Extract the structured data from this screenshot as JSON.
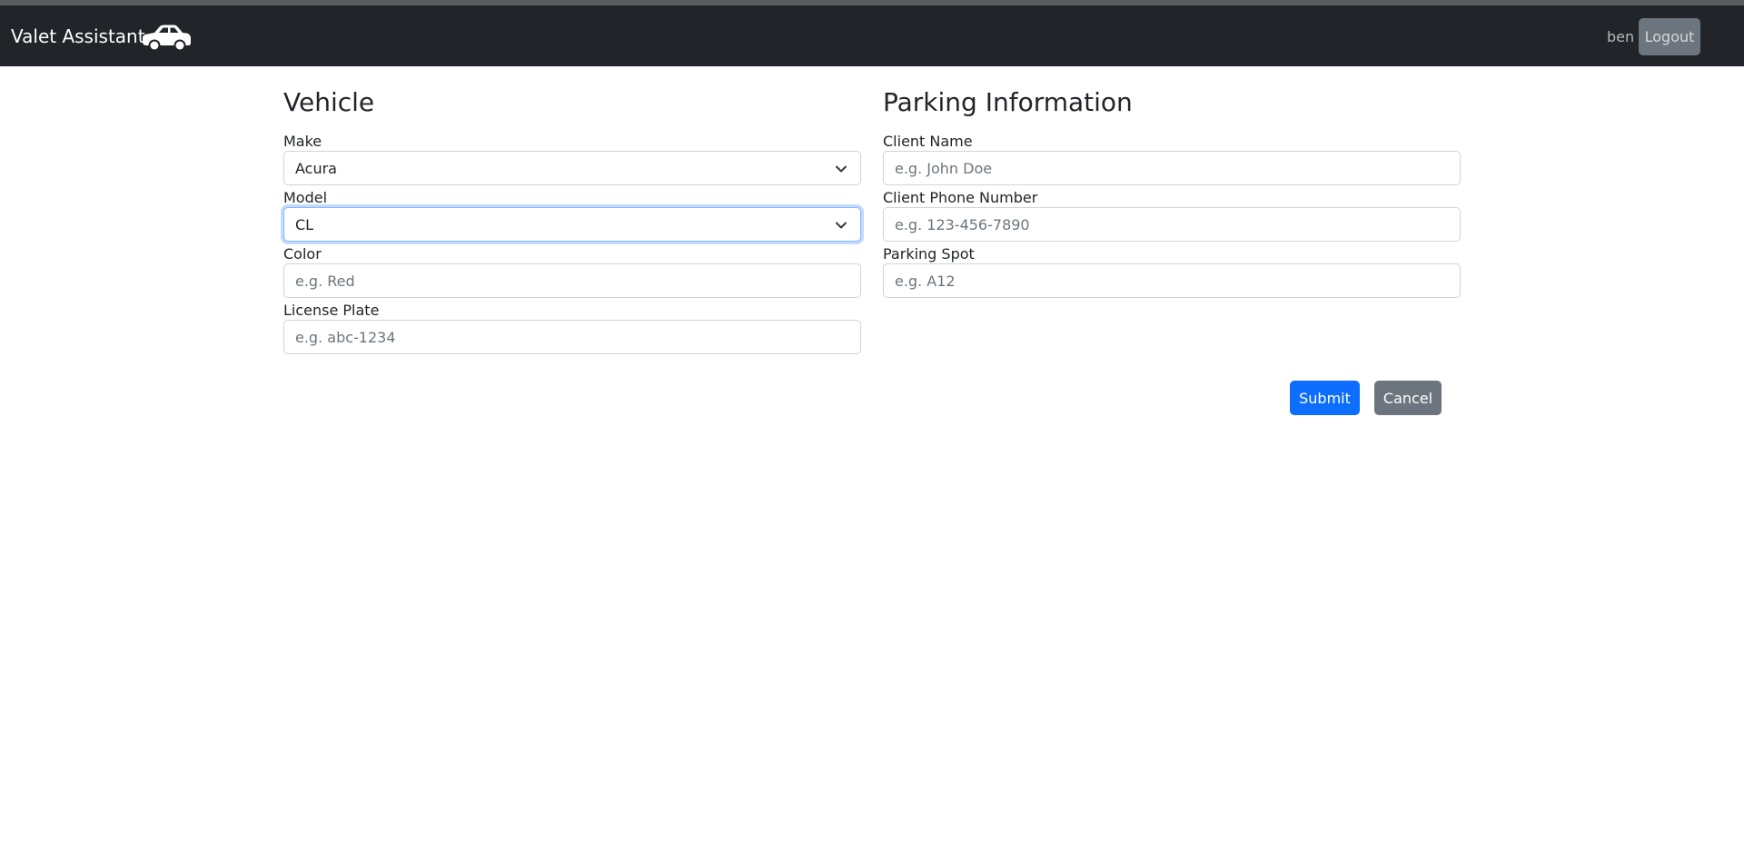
{
  "navbar": {
    "brand": "Valet Assistant",
    "brand_icon": "car-icon",
    "username": "ben",
    "logout_label": "Logout"
  },
  "vehicle": {
    "title": "Vehicle",
    "make": {
      "label": "Make",
      "value": "Acura"
    },
    "model": {
      "label": "Model",
      "value": "CL"
    },
    "color": {
      "label": "Color",
      "placeholder": "e.g. Red"
    },
    "license_plate": {
      "label": "License Plate",
      "placeholder": "e.g. abc-1234"
    }
  },
  "parking": {
    "title": "Parking Information",
    "client_name": {
      "label": "Client Name",
      "placeholder": "e.g. John Doe"
    },
    "client_phone": {
      "label": "Client Phone Number",
      "placeholder": "e.g. 123-456-7890"
    },
    "parking_spot": {
      "label": "Parking Spot",
      "placeholder": "e.g. A12"
    }
  },
  "actions": {
    "submit_label": "Submit",
    "cancel_label": "Cancel"
  },
  "colors": {
    "navbar_bg": "#212529",
    "primary": "#0d6efd",
    "secondary": "#6c757d",
    "focus_border": "#86b7fe"
  }
}
